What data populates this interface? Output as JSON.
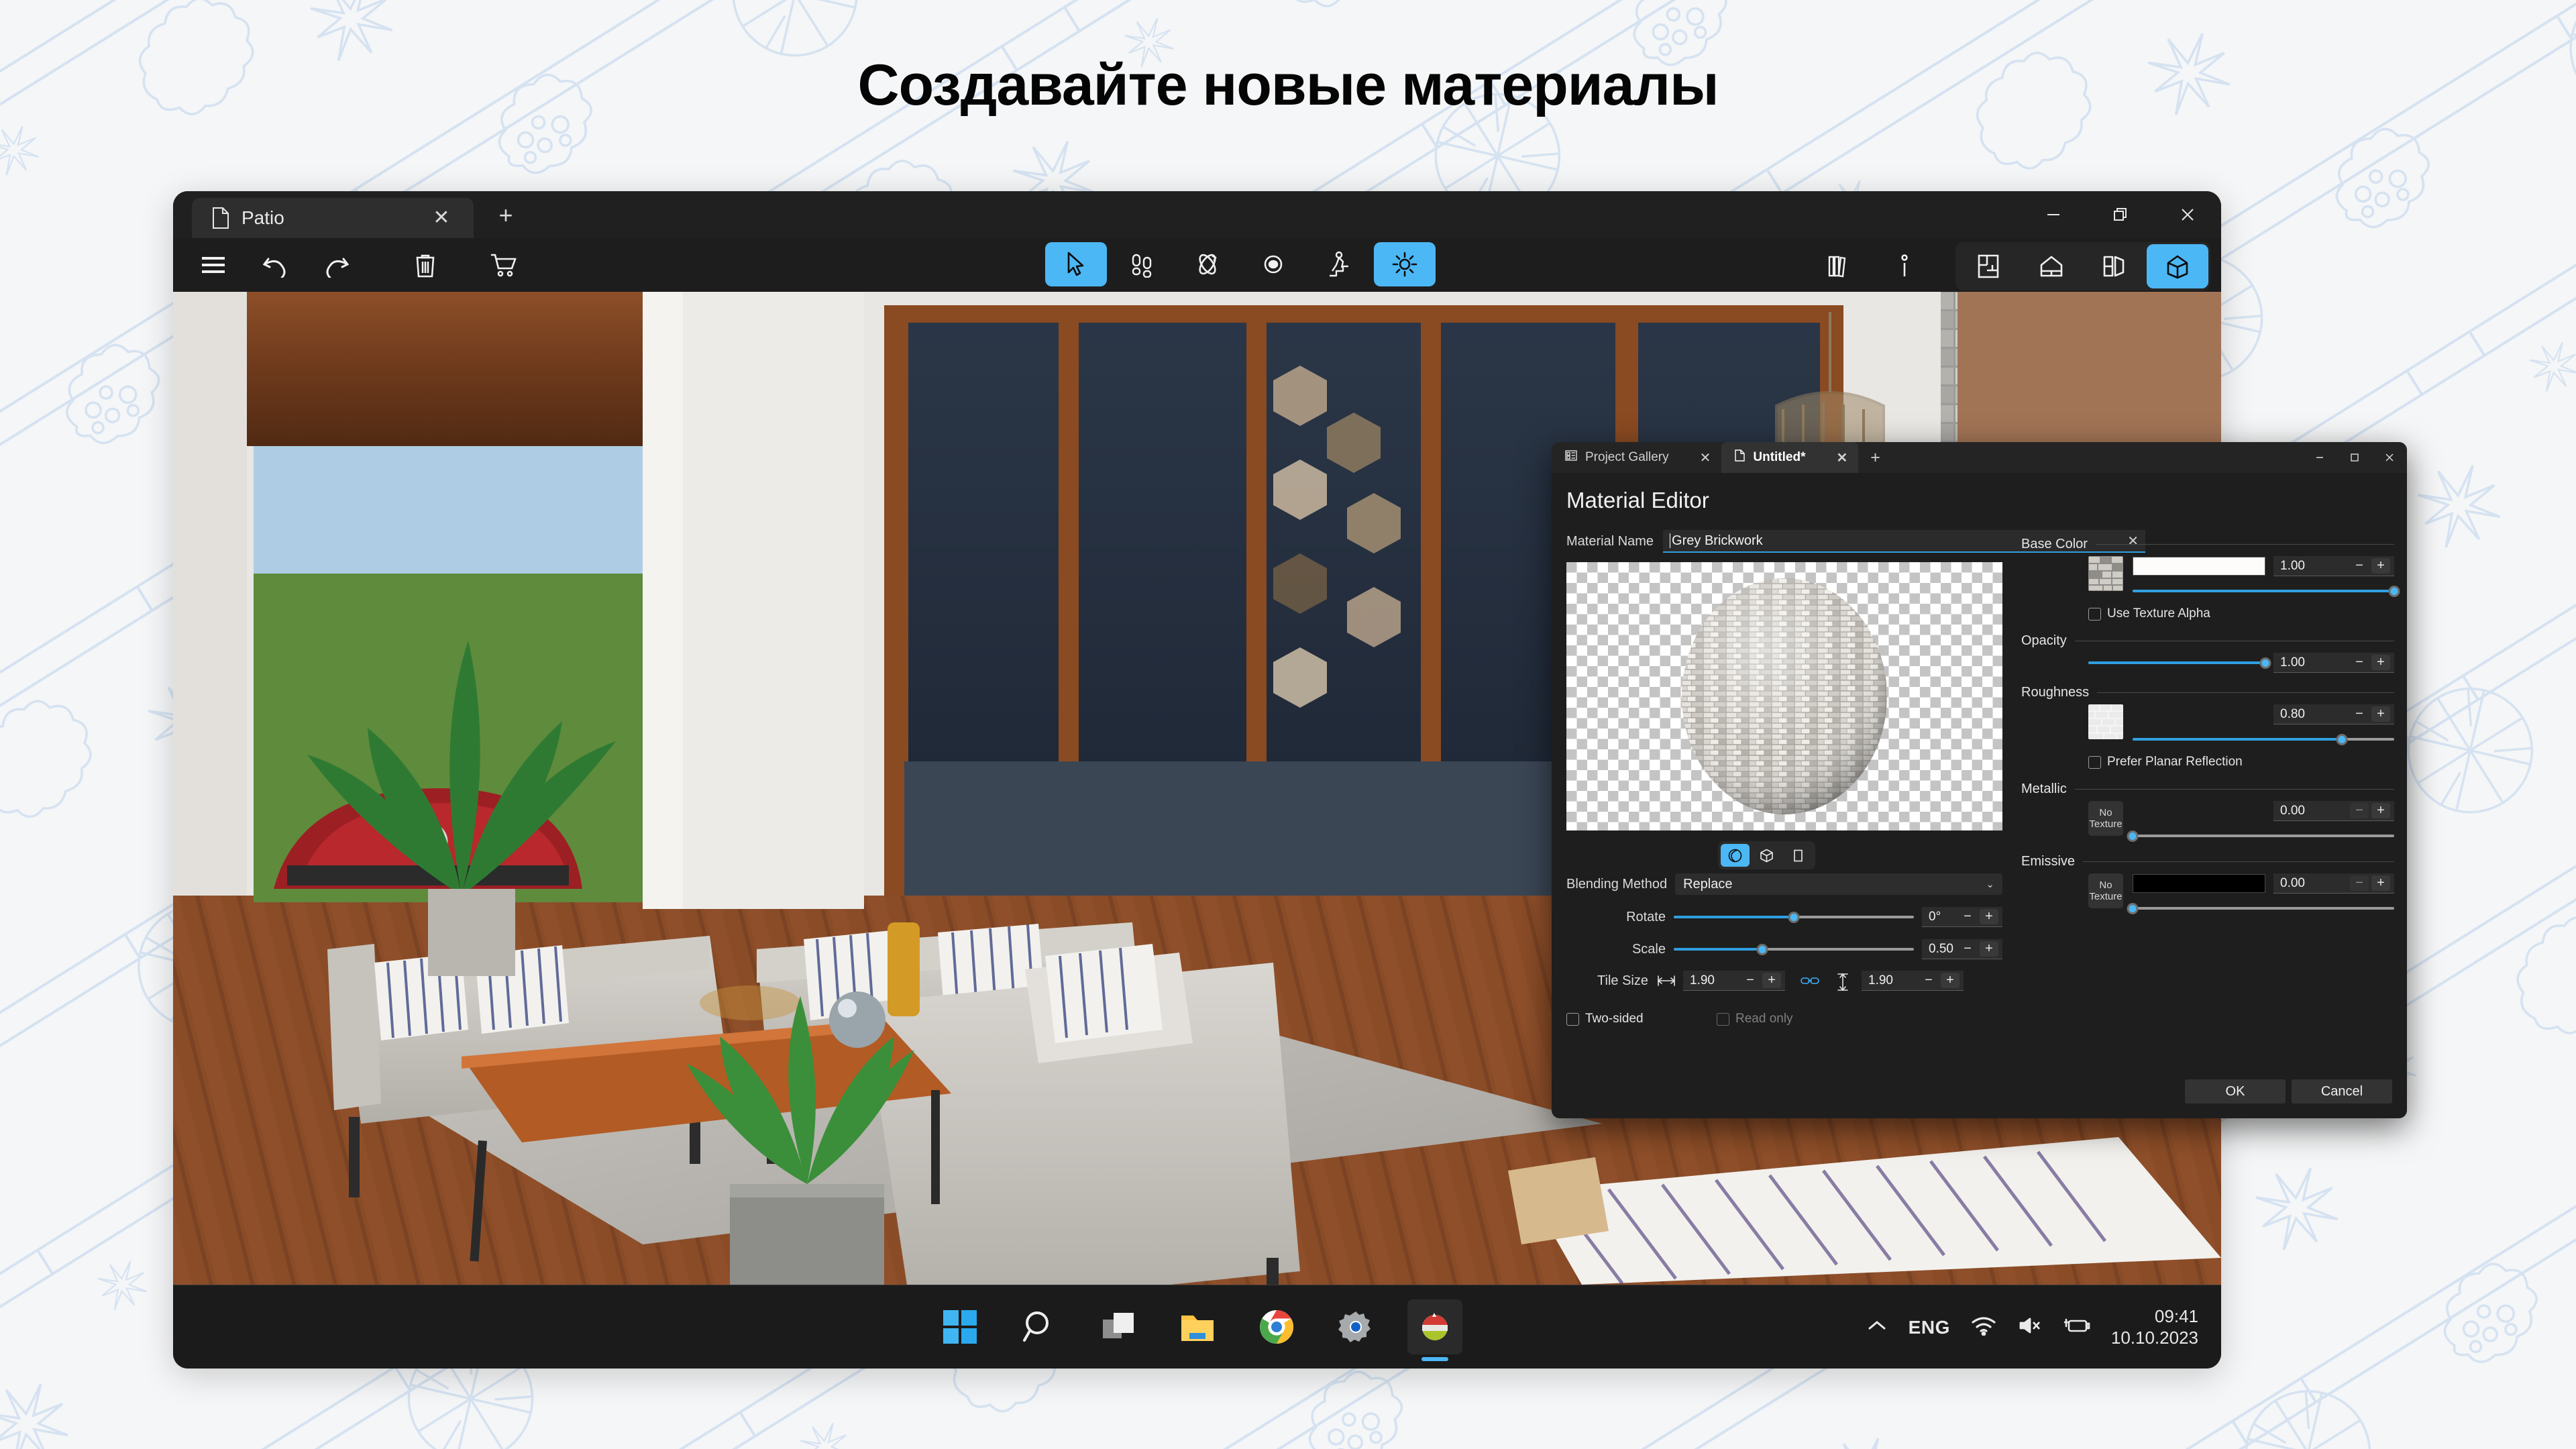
{
  "page": {
    "title": "Создавайте новые материалы",
    "background_color": "#f5f6f7",
    "blueprint_line_color": "#cbdcef",
    "accent_color": "#4cb7f5"
  },
  "app_window": {
    "tab": {
      "label": "Patio",
      "icon": "document-icon",
      "close_label": "✕"
    },
    "new_tab_label": "+",
    "window_controls": {
      "minimize": "—",
      "restore": "❐",
      "close": "✕"
    },
    "toolbar_left": [
      {
        "name": "menu-icon",
        "label": "Menu"
      },
      {
        "name": "undo-icon",
        "label": "Undo"
      },
      {
        "name": "redo-icon",
        "label": "Redo"
      },
      {
        "name": "trash-icon",
        "label": "Delete"
      },
      {
        "name": "cart-icon",
        "label": "Cart"
      }
    ],
    "toolbar_center": [
      {
        "name": "cursor-icon",
        "label": "Select",
        "active": true
      },
      {
        "name": "footsteps-icon",
        "label": "Walk",
        "active": false
      },
      {
        "name": "orbit-icon",
        "label": "Orbit",
        "active": false
      },
      {
        "name": "eye-icon",
        "label": "View",
        "active": false
      },
      {
        "name": "stairs-walk-icon",
        "label": "Climb",
        "active": false
      },
      {
        "name": "sun-icon",
        "label": "Lighting",
        "active": true
      }
    ],
    "toolbar_right": [
      {
        "name": "library-icon",
        "label": "Library",
        "active": false
      },
      {
        "name": "info-icon",
        "label": "Info",
        "active": false
      }
    ],
    "view_modes": [
      {
        "name": "floorplan-2d-icon",
        "label": "2D Plan",
        "active": false
      },
      {
        "name": "elevation-icon",
        "label": "Elevation",
        "active": false
      },
      {
        "name": "section-icon",
        "label": "Section",
        "active": false
      },
      {
        "name": "3d-view-icon",
        "label": "3D View",
        "active": true
      }
    ]
  },
  "taskbar": {
    "items": [
      {
        "name": "windows-start-icon",
        "label": "Start"
      },
      {
        "name": "search-icon",
        "label": "Search"
      },
      {
        "name": "task-view-icon",
        "label": "Task View"
      },
      {
        "name": "file-explorer-icon",
        "label": "File Explorer"
      },
      {
        "name": "chrome-icon",
        "label": "Google Chrome"
      },
      {
        "name": "settings-icon",
        "label": "Settings"
      },
      {
        "name": "live-home-3d-icon",
        "label": "Live Home 3D",
        "pinned": true
      }
    ],
    "tray": {
      "chevron": "⌃",
      "language": "ENG",
      "wifi": "wifi-icon",
      "volume": "volume-muted-icon",
      "battery": "battery-charging-icon",
      "time": "09:41",
      "date": "10.10.2023"
    }
  },
  "material_editor": {
    "tabs": [
      {
        "label": "Project Gallery",
        "icon": "gallery-icon",
        "active": false,
        "close": "✕"
      },
      {
        "label": "Untitled*",
        "icon": "document-icon",
        "active": true,
        "close": "✕"
      }
    ],
    "new_tab_label": "+",
    "window_controls": {
      "minimize": "—",
      "maximize": "□",
      "close": "✕"
    },
    "heading": "Material Editor",
    "material_name": {
      "label": "Material Name",
      "value": "Grey Brickwork",
      "clear": "✕"
    },
    "preview_shapes": [
      {
        "name": "sphere-preview-icon",
        "label": "Sphere",
        "active": true
      },
      {
        "name": "cube-preview-icon",
        "label": "Cube",
        "active": false
      },
      {
        "name": "plane-preview-icon",
        "label": "Plane",
        "active": false
      }
    ],
    "blending": {
      "label": "Blending Method",
      "value": "Replace",
      "chevron": "⌄"
    },
    "rotate": {
      "label": "Rotate",
      "value": "0°",
      "slider_pct": 50,
      "minus": "−",
      "plus": "+"
    },
    "scale": {
      "label": "Scale",
      "value": "0.50",
      "slider_pct": 37,
      "minus": "−",
      "plus": "+"
    },
    "tile_size": {
      "label": "Tile Size",
      "width_icon": "horizontal-extent-icon",
      "width": "1.90",
      "link_icon": "link-chain-icon",
      "height_icon": "vertical-extent-icon",
      "height": "1.90",
      "minus": "−",
      "plus": "+"
    },
    "two_sided": {
      "label": "Two-sided",
      "checked": false
    },
    "read_only": {
      "label": "Read only",
      "checked": false,
      "disabled": true
    },
    "properties": [
      {
        "name": "Base Color",
        "texture": "brick-texture",
        "swatch_color": "#fdfcfb",
        "value": "1.00",
        "slider_pct": 100,
        "minus": "−",
        "plus": "+",
        "checkbox": {
          "label": "Use Texture Alpha",
          "checked": false
        }
      },
      {
        "name": "Opacity",
        "texture": null,
        "swatch_color": null,
        "value": "1.00",
        "slider_pct": 100,
        "minus": "−",
        "plus": "+",
        "checkbox": null
      },
      {
        "name": "Roughness",
        "texture": "roughness-texture",
        "swatch_color": null,
        "value": "0.80",
        "slider_pct": 80,
        "minus": "−",
        "plus": "+",
        "checkbox": {
          "label": "Prefer Planar Reflection",
          "checked": false
        }
      },
      {
        "name": "Metallic",
        "texture": "no-texture",
        "no_texture_label": "No\nTexture",
        "swatch_color": null,
        "value": "0.00",
        "slider_pct": 0,
        "minus": "−",
        "plus": "+",
        "checkbox": null
      },
      {
        "name": "Emissive",
        "texture": "no-texture",
        "no_texture_label": "No\nTexture",
        "swatch_color": "#000000",
        "value": "0.00",
        "slider_pct": 0,
        "minus": "−",
        "plus": "+",
        "checkbox": null
      }
    ],
    "buttons": {
      "ok": "OK",
      "cancel": "Cancel"
    }
  }
}
